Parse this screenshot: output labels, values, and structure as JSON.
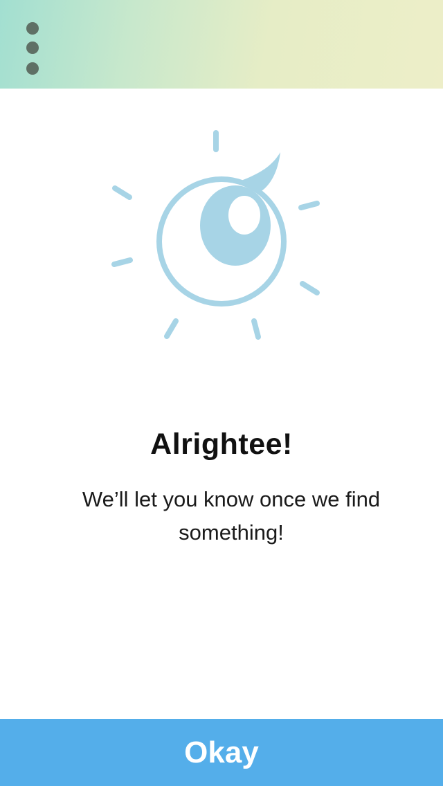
{
  "header": {
    "menu_icon": "more-vertical-icon"
  },
  "illustration": {
    "icon": "sun-eye-icon",
    "color": "#a7d4e6"
  },
  "content": {
    "title": "Alrightee!",
    "message": "We’ll let you know once we find something!"
  },
  "footer": {
    "okay_label": "Okay",
    "button_color": "#54aeea"
  }
}
